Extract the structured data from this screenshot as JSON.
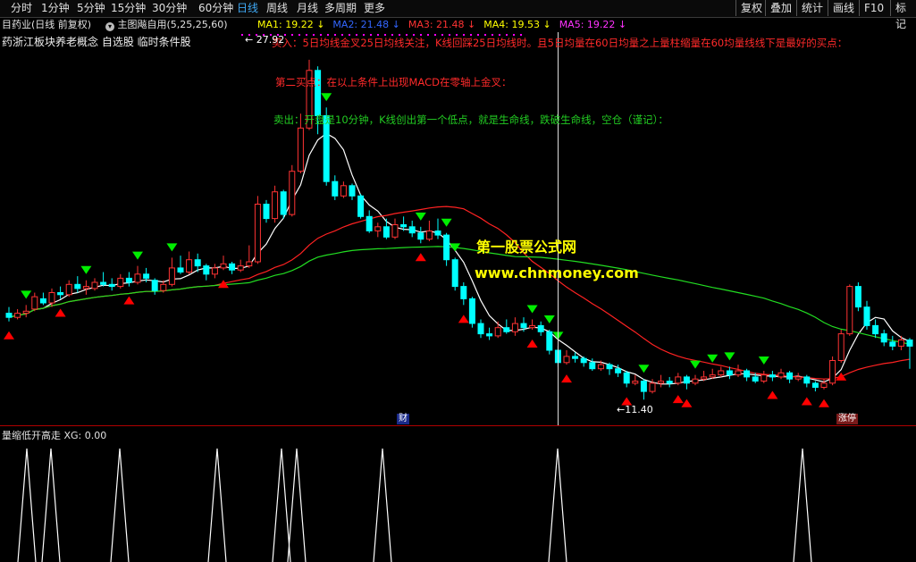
{
  "toolbar": {
    "tabs": [
      "分时",
      "1分钟",
      "5分钟",
      "15分钟",
      "30分钟",
      "60分钟",
      "日线",
      "周线",
      "月线",
      "多周期",
      "更多"
    ],
    "active_tab": "日线",
    "right_buttons": [
      "复权",
      "叠加",
      "统计",
      "画线",
      "F10",
      "标记"
    ]
  },
  "info": {
    "stock": "目药业(日线 前复权)",
    "formula": "主图飚自用(5,25,25,60)",
    "ma": [
      {
        "label": "MA1: 19.22",
        "color": "#ffff00"
      },
      {
        "label": "MA2: 21.48",
        "color": "#3366ff"
      },
      {
        "label": "MA3: 21.48",
        "color": "#ff3333"
      },
      {
        "label": "MA4: 19.53",
        "color": "#ffff00"
      },
      {
        "label": "MA5: 19.22",
        "color": "#ff33ff"
      }
    ]
  },
  "sub_title": "药浙江板块养老概念 自选股 临时条件股",
  "notes": {
    "buy1": "买入：5日均线金叉25日均线关注，K线回踩25日均线时。且5日均量在60日均量之上量柱缩量在60均量线线下是最好的买点：",
    "buy2": "第二买点：在以上条件上出现MACD在零轴上金叉：",
    "sell": "卖出：开盘是10分钟，K线创出第一个低点，就是生命线，跌破生命线，空仓（谨记）："
  },
  "price_labels": {
    "high": "27.92",
    "low": "11.40"
  },
  "markers": {
    "cai": "财",
    "zhangting": "涨停"
  },
  "watermark": {
    "line1": "第一股票公式网",
    "line2": "www.chnmoney.com"
  },
  "indicator": {
    "title": "量缩低开高走  XG: 0.00",
    "signals": [
      1,
      1,
      0,
      0,
      0,
      1,
      0,
      0,
      1,
      0,
      0,
      0,
      0,
      0,
      0,
      0,
      1,
      0,
      0,
      1,
      0,
      0,
      0,
      0,
      0,
      0,
      1,
      0,
      0,
      0,
      0,
      1,
      0,
      0,
      0,
      1,
      1,
      0,
      0,
      0,
      1,
      0,
      0,
      0,
      0,
      1,
      0,
      0,
      0,
      0,
      0,
      0,
      0,
      0,
      0,
      0,
      0,
      0,
      1,
      0
    ]
  },
  "colors": {
    "up": "#ff3333",
    "down": "#00ffff",
    "ma_white": "#ffffff",
    "ma_red": "#ff2222",
    "ma_green": "#22dd22",
    "buy_arrow": "#ff0000",
    "sell_arrow": "#00ee00"
  },
  "chart_data": {
    "type": "candlestick",
    "price_range": [
      10.5,
      29.0
    ],
    "candles": [
      {
        "o": 15.6,
        "c": 15.4,
        "h": 15.9,
        "l": 15.2
      },
      {
        "o": 15.4,
        "c": 15.6,
        "h": 15.8,
        "l": 15.3
      },
      {
        "o": 15.6,
        "c": 15.7,
        "h": 16.0,
        "l": 15.4
      },
      {
        "o": 15.8,
        "c": 16.4,
        "h": 16.6,
        "l": 15.7
      },
      {
        "o": 16.3,
        "c": 16.1,
        "h": 16.6,
        "l": 16.0
      },
      {
        "o": 16.1,
        "c": 16.6,
        "h": 16.8,
        "l": 15.9
      },
      {
        "o": 16.6,
        "c": 16.5,
        "h": 16.9,
        "l": 16.3
      },
      {
        "o": 16.5,
        "c": 17.0,
        "h": 17.2,
        "l": 16.4
      },
      {
        "o": 17.0,
        "c": 16.8,
        "h": 17.4,
        "l": 16.6
      },
      {
        "o": 16.8,
        "c": 16.9,
        "h": 17.2,
        "l": 16.5
      },
      {
        "o": 16.8,
        "c": 17.1,
        "h": 17.3,
        "l": 16.7
      },
      {
        "o": 17.1,
        "c": 17.0,
        "h": 17.6,
        "l": 16.9
      },
      {
        "o": 17.0,
        "c": 16.9,
        "h": 17.3,
        "l": 16.7
      },
      {
        "o": 16.9,
        "c": 17.3,
        "h": 17.5,
        "l": 16.8
      },
      {
        "o": 17.3,
        "c": 17.1,
        "h": 17.6,
        "l": 16.9
      },
      {
        "o": 17.1,
        "c": 17.5,
        "h": 17.9,
        "l": 17.0
      },
      {
        "o": 17.5,
        "c": 17.3,
        "h": 17.8,
        "l": 17.1
      },
      {
        "o": 17.2,
        "c": 16.7,
        "h": 17.3,
        "l": 16.5
      },
      {
        "o": 16.7,
        "c": 17.0,
        "h": 17.2,
        "l": 16.6
      },
      {
        "o": 17.0,
        "c": 17.8,
        "h": 18.3,
        "l": 16.9
      },
      {
        "o": 17.8,
        "c": 17.6,
        "h": 18.4,
        "l": 17.5
      },
      {
        "o": 17.6,
        "c": 18.2,
        "h": 18.6,
        "l": 17.5
      },
      {
        "o": 18.2,
        "c": 17.9,
        "h": 18.5,
        "l": 17.6
      },
      {
        "o": 17.9,
        "c": 17.5,
        "h": 18.0,
        "l": 17.2
      },
      {
        "o": 17.5,
        "c": 17.8,
        "h": 18.0,
        "l": 17.3
      },
      {
        "o": 17.8,
        "c": 18.0,
        "h": 18.4,
        "l": 17.7
      },
      {
        "o": 18.0,
        "c": 17.7,
        "h": 18.1,
        "l": 17.5
      },
      {
        "o": 17.7,
        "c": 17.9,
        "h": 18.2,
        "l": 17.6
      },
      {
        "o": 17.9,
        "c": 18.1,
        "h": 18.9,
        "l": 17.8
      },
      {
        "o": 18.1,
        "c": 20.9,
        "h": 21.3,
        "l": 18.0
      },
      {
        "o": 20.9,
        "c": 20.2,
        "h": 21.1,
        "l": 20.0
      },
      {
        "o": 20.2,
        "c": 21.5,
        "h": 21.8,
        "l": 20.0
      },
      {
        "o": 21.5,
        "c": 20.4,
        "h": 21.6,
        "l": 20.2
      },
      {
        "o": 20.4,
        "c": 22.5,
        "h": 22.8,
        "l": 20.3
      },
      {
        "o": 22.5,
        "c": 24.6,
        "h": 25.3,
        "l": 22.4
      },
      {
        "o": 24.6,
        "c": 27.4,
        "h": 27.92,
        "l": 24.5
      },
      {
        "o": 27.4,
        "c": 25.2,
        "h": 27.6,
        "l": 24.3
      },
      {
        "o": 25.2,
        "c": 22.0,
        "h": 25.6,
        "l": 21.8
      },
      {
        "o": 22.0,
        "c": 21.3,
        "h": 22.3,
        "l": 21.1
      },
      {
        "o": 21.3,
        "c": 21.8,
        "h": 22.0,
        "l": 21.2
      },
      {
        "o": 21.8,
        "c": 21.3,
        "h": 21.9,
        "l": 21.1
      },
      {
        "o": 21.3,
        "c": 20.3,
        "h": 21.4,
        "l": 20.2
      },
      {
        "o": 20.3,
        "c": 19.6,
        "h": 20.6,
        "l": 19.5
      },
      {
        "o": 19.6,
        "c": 19.8,
        "h": 20.0,
        "l": 19.3
      },
      {
        "o": 19.8,
        "c": 19.3,
        "h": 20.2,
        "l": 19.2
      },
      {
        "o": 19.3,
        "c": 19.9,
        "h": 20.2,
        "l": 19.2
      },
      {
        "o": 19.9,
        "c": 19.8,
        "h": 20.3,
        "l": 19.6
      },
      {
        "o": 19.8,
        "c": 19.5,
        "h": 20.1,
        "l": 19.3
      },
      {
        "o": 19.5,
        "c": 19.2,
        "h": 19.8,
        "l": 19.0
      },
      {
        "o": 19.2,
        "c": 19.6,
        "h": 20.1,
        "l": 19.1
      },
      {
        "o": 19.6,
        "c": 19.4,
        "h": 20.2,
        "l": 19.2
      },
      {
        "o": 19.4,
        "c": 18.2,
        "h": 19.5,
        "l": 17.9
      },
      {
        "o": 18.2,
        "c": 16.9,
        "h": 18.3,
        "l": 16.7
      },
      {
        "o": 16.9,
        "c": 16.3,
        "h": 17.1,
        "l": 16.0
      },
      {
        "o": 16.3,
        "c": 15.1,
        "h": 16.4,
        "l": 14.9
      },
      {
        "o": 15.1,
        "c": 14.6,
        "h": 15.3,
        "l": 14.4
      },
      {
        "o": 14.6,
        "c": 14.5,
        "h": 14.9,
        "l": 14.3
      },
      {
        "o": 14.5,
        "c": 14.9,
        "h": 15.2,
        "l": 14.4
      },
      {
        "o": 14.9,
        "c": 14.7,
        "h": 15.3,
        "l": 14.6
      },
      {
        "o": 14.7,
        "c": 15.1,
        "h": 15.4,
        "l": 14.5
      },
      {
        "o": 15.1,
        "c": 14.9,
        "h": 15.4,
        "l": 14.7
      },
      {
        "o": 14.9,
        "c": 15.0,
        "h": 15.3,
        "l": 14.8
      },
      {
        "o": 15.0,
        "c": 14.7,
        "h": 15.2,
        "l": 14.5
      },
      {
        "o": 14.7,
        "c": 13.8,
        "h": 14.8,
        "l": 13.6
      },
      {
        "o": 13.8,
        "c": 13.2,
        "h": 14.0,
        "l": 13.0
      },
      {
        "o": 13.2,
        "c": 13.5,
        "h": 13.8,
        "l": 13.1
      },
      {
        "o": 13.5,
        "c": 13.4,
        "h": 13.7,
        "l": 13.2
      },
      {
        "o": 13.4,
        "c": 13.2,
        "h": 13.5,
        "l": 13.0
      },
      {
        "o": 13.2,
        "c": 12.9,
        "h": 13.4,
        "l": 12.8
      },
      {
        "o": 12.9,
        "c": 13.1,
        "h": 13.3,
        "l": 12.8
      },
      {
        "o": 13.1,
        "c": 12.9,
        "h": 13.2,
        "l": 12.6
      },
      {
        "o": 12.9,
        "c": 12.7,
        "h": 13.1,
        "l": 12.5
      },
      {
        "o": 12.7,
        "c": 12.2,
        "h": 12.8,
        "l": 12.0
      },
      {
        "o": 12.2,
        "c": 12.3,
        "h": 12.6,
        "l": 12.1
      },
      {
        "o": 12.3,
        "c": 11.8,
        "h": 12.4,
        "l": 11.4
      },
      {
        "o": 11.8,
        "c": 12.2,
        "h": 12.4,
        "l": 11.7
      },
      {
        "o": 12.2,
        "c": 12.3,
        "h": 12.6,
        "l": 12.0
      },
      {
        "o": 12.3,
        "c": 12.2,
        "h": 12.5,
        "l": 12.0
      },
      {
        "o": 12.2,
        "c": 12.5,
        "h": 12.7,
        "l": 12.1
      },
      {
        "o": 12.5,
        "c": 12.2,
        "h": 12.6,
        "l": 11.9
      },
      {
        "o": 12.2,
        "c": 12.4,
        "h": 12.6,
        "l": 12.1
      },
      {
        "o": 12.4,
        "c": 12.5,
        "h": 12.8,
        "l": 12.3
      },
      {
        "o": 12.5,
        "c": 12.6,
        "h": 12.9,
        "l": 12.4
      },
      {
        "o": 12.6,
        "c": 12.8,
        "h": 13.0,
        "l": 12.5
      },
      {
        "o": 12.8,
        "c": 12.6,
        "h": 13.0,
        "l": 12.4
      },
      {
        "o": 12.6,
        "c": 12.8,
        "h": 13.1,
        "l": 12.5
      },
      {
        "o": 12.8,
        "c": 12.5,
        "h": 12.9,
        "l": 12.3
      },
      {
        "o": 12.5,
        "c": 12.3,
        "h": 12.7,
        "l": 12.2
      },
      {
        "o": 12.3,
        "c": 12.6,
        "h": 12.8,
        "l": 12.2
      },
      {
        "o": 12.6,
        "c": 12.5,
        "h": 12.8,
        "l": 12.3
      },
      {
        "o": 12.5,
        "c": 12.7,
        "h": 12.9,
        "l": 12.4
      },
      {
        "o": 12.7,
        "c": 12.4,
        "h": 12.8,
        "l": 12.2
      },
      {
        "o": 12.4,
        "c": 12.5,
        "h": 12.7,
        "l": 12.3
      },
      {
        "o": 12.5,
        "c": 12.2,
        "h": 12.6,
        "l": 12.0
      },
      {
        "o": 12.2,
        "c": 12.0,
        "h": 12.3,
        "l": 11.8
      },
      {
        "o": 12.0,
        "c": 12.2,
        "h": 12.4,
        "l": 11.9
      },
      {
        "o": 12.2,
        "c": 13.3,
        "h": 13.5,
        "l": 12.1
      },
      {
        "o": 13.3,
        "c": 14.6,
        "h": 14.8,
        "l": 13.2
      },
      {
        "o": 14.6,
        "c": 16.9,
        "h": 17.0,
        "l": 14.5
      },
      {
        "o": 16.9,
        "c": 15.9,
        "h": 17.1,
        "l": 15.7
      },
      {
        "o": 15.9,
        "c": 15.0,
        "h": 16.2,
        "l": 14.8
      },
      {
        "o": 15.0,
        "c": 14.6,
        "h": 15.3,
        "l": 14.4
      },
      {
        "o": 14.6,
        "c": 14.2,
        "h": 14.8,
        "l": 14.0
      },
      {
        "o": 14.2,
        "c": 14.0,
        "h": 14.5,
        "l": 13.8
      },
      {
        "o": 14.0,
        "c": 14.3,
        "h": 14.5,
        "l": 13.8
      },
      {
        "o": 14.3,
        "c": 14.0,
        "h": 14.4,
        "l": 12.9
      }
    ]
  }
}
